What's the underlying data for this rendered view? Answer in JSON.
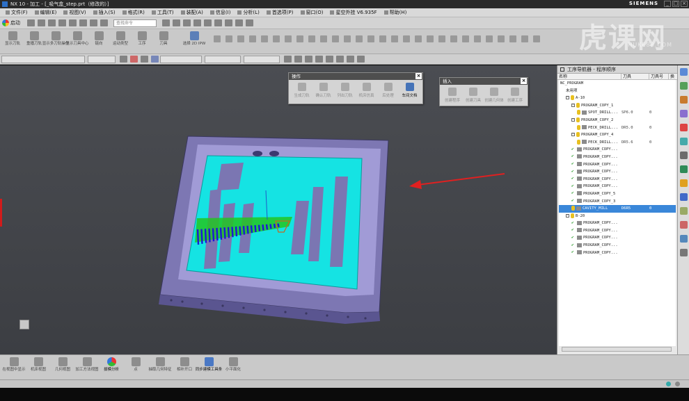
{
  "window": {
    "title": "NX 10 - 加工 - [_吸气盒_step.prt（修改的）]",
    "brand": "SIEMENS"
  },
  "menu": [
    "文件(F)",
    "编辑(E)",
    "视图(V)",
    "插入(S)",
    "格式(R)",
    "工具(T)",
    "装配(A)",
    "信息(I)",
    "分析(L)",
    "首选项(P)",
    "窗口(O)",
    "星空外挂 V6.935F",
    "帮助(H)"
  ],
  "toolbar1": {
    "launch_label": "启动",
    "search_placeholder": "查找命令"
  },
  "toolbar2": {
    "buttons": [
      "显示刀轨",
      "重播刀轨",
      "显示多刀轨操作",
      "显示刀具中心",
      "链向",
      "运动类型",
      "工序",
      "刀具"
    ],
    "select_label": "选择 2D IPW"
  },
  "report_panel": {
    "title": "操作",
    "buttons": [
      "生成刀轨",
      "确认刀轨",
      "列出刀轨",
      "机床仿真",
      "后处理",
      "车间文档"
    ]
  },
  "insert_panel": {
    "title": "插入",
    "buttons": [
      "创建程序",
      "创建刀具",
      "创建几何体",
      "创建工序"
    ]
  },
  "navigator": {
    "title": "工序导航器 - 程序顺序",
    "columns": [
      "名称",
      "刀具",
      "刀具号",
      "换"
    ],
    "rows": [
      {
        "indent": 0,
        "name": "NC_PROGRAM",
        "tool": "",
        "num": ""
      },
      {
        "indent": 1,
        "name": "未用项",
        "tool": "",
        "num": ""
      },
      {
        "indent": 1,
        "name": "A-10",
        "tool": "",
        "num": "",
        "group": true
      },
      {
        "indent": 2,
        "name": "PROGRAM_COPY_1",
        "tool": "",
        "num": "",
        "group": true
      },
      {
        "indent": 3,
        "name": "SPOT_DRILL...",
        "tool": "SP6.0",
        "num": "0"
      },
      {
        "indent": 2,
        "name": "PROGRAM_COPY_2",
        "tool": "",
        "num": "",
        "group": true
      },
      {
        "indent": 3,
        "name": "PECK_DRILL...",
        "tool": "DR5.0",
        "num": "0"
      },
      {
        "indent": 2,
        "name": "PROGRAM_COPY_4",
        "tool": "",
        "num": "",
        "group": true
      },
      {
        "indent": 3,
        "name": "PECK_DRILL...",
        "tool": "DR5.6",
        "num": "0"
      },
      {
        "indent": 2,
        "name": "PROGRAM_COPY...",
        "tool": "",
        "num": "",
        "check": true
      },
      {
        "indent": 2,
        "name": "PROGRAM_COPY...",
        "tool": "",
        "num": "",
        "check": true
      },
      {
        "indent": 2,
        "name": "PROGRAM_COPY...",
        "tool": "",
        "num": "",
        "check": true
      },
      {
        "indent": 2,
        "name": "PROGRAM_COPY...",
        "tool": "",
        "num": "",
        "check": true
      },
      {
        "indent": 2,
        "name": "PROGRAM_COPY...",
        "tool": "",
        "num": "",
        "check": true
      },
      {
        "indent": 2,
        "name": "PROGRAM_COPY...",
        "tool": "",
        "num": "",
        "check": true
      },
      {
        "indent": 2,
        "name": "PROGRAM_COPY_5",
        "tool": "",
        "num": "",
        "check": true
      },
      {
        "indent": 2,
        "name": "PROGRAM_COPY_3",
        "tool": "",
        "num": "",
        "check": true
      },
      {
        "indent": 2,
        "name": "CAVITY_MILL",
        "tool": "D6R5",
        "num": "0",
        "selected": true
      },
      {
        "indent": 1,
        "name": "B-20",
        "tool": "",
        "num": "",
        "group": true
      },
      {
        "indent": 2,
        "name": "PROGRAM_COPY...",
        "tool": "",
        "num": "",
        "check": true
      },
      {
        "indent": 2,
        "name": "PROGRAM_COPY...",
        "tool": "",
        "num": "",
        "check": true
      },
      {
        "indent": 2,
        "name": "PROGRAM_COPY...",
        "tool": "",
        "num": "",
        "check": true
      },
      {
        "indent": 2,
        "name": "PROGRAM_COPY...",
        "tool": "",
        "num": "",
        "check": true
      },
      {
        "indent": 2,
        "name": "PROGRAM_COPY...",
        "tool": "",
        "num": "",
        "check": true
      }
    ]
  },
  "bottom_toolbar": {
    "buttons": [
      "在视图中显示",
      "机床视图",
      "几何视图",
      "加工方法视图",
      "拔模分析",
      "点",
      "抽取几何特征",
      "相补开口",
      "同步建模工具条",
      "小平面化"
    ]
  },
  "watermark": {
    "main": "虎课网",
    "sub": "HUKE88.COM"
  },
  "colors": {
    "viewport_bg": "#464850",
    "part_frame": "#8d86c4",
    "cavity_floor": "#14e2e2",
    "selection": "#3a87d9",
    "arrow": "#e02020"
  }
}
